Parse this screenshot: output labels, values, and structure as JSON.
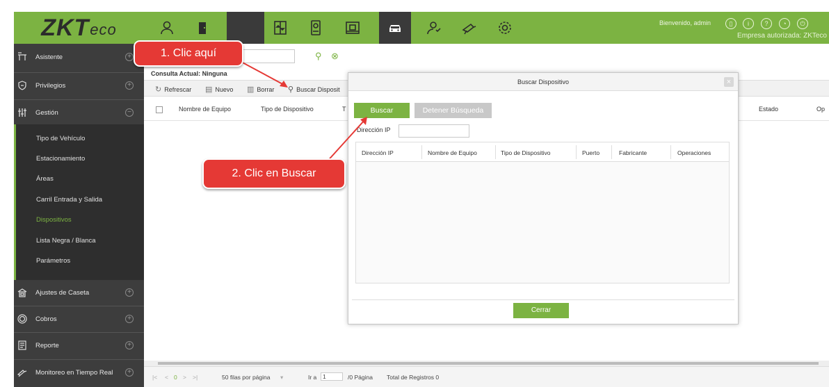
{
  "app": {
    "logo_main": "ZKT",
    "logo_small": "eco",
    "welcome": "Bienvenido, admin",
    "company": "Empresa autorizada: ZKTeco",
    "brand_color": "#7cb342"
  },
  "top_nav": {
    "icons": [
      "person-icon",
      "door-icon",
      "blank-module",
      "elevator-icon",
      "id-card-icon",
      "parking-card-icon",
      "car-icon",
      "guard-icon",
      "camera-icon",
      "gear-icon"
    ],
    "active_index": 2
  },
  "right_icons": [
    "user-icon",
    "info-icon",
    "help-icon",
    "clock-icon",
    "power-icon"
  ],
  "sidebar": {
    "sections": [
      {
        "label": "Asistente",
        "icon": "assistant-icon",
        "state": "+"
      },
      {
        "label": "Privilegios",
        "icon": "shield-icon",
        "state": "+"
      },
      {
        "label": "Gestión",
        "icon": "sliders-icon",
        "state": "−"
      }
    ],
    "sub_items": [
      "Tipo de Vehículo",
      "Estacionamiento",
      "Áreas",
      "Carril Entrada y Salida",
      "Dispositivos",
      "Lista Negra / Blanca",
      "Parámetros"
    ],
    "active_sub": "Dispositivos",
    "bottom_sections": [
      {
        "label": "Ajustes de Caseta",
        "icon": "booth-icon",
        "state": "+"
      },
      {
        "label": "Cobros",
        "icon": "coin-icon",
        "state": "+"
      },
      {
        "label": "Reporte",
        "icon": "report-icon",
        "state": "+"
      },
      {
        "label": "Monitoreo en Tiempo Real",
        "icon": "monitor-icon",
        "state": "+"
      }
    ]
  },
  "main": {
    "consulta": "Consulta Actual: Ninguna",
    "toolbar": {
      "refresh": "Refrescar",
      "new": "Nuevo",
      "delete": "Borrar",
      "search_device": "Buscar Disposit"
    },
    "columns": [
      "Nombre de Equipo",
      "Tipo de Dispositivo",
      "T",
      "Estado",
      "Op"
    ],
    "pager": {
      "nav_first": "|<",
      "nav_prev": "<",
      "current": "0",
      "nav_next": ">",
      "nav_last": ">|",
      "per_page": "50 filas por página",
      "goto_label": "Ir a",
      "goto_value": "1",
      "pages": "/0 Página",
      "total": "Total de Registros 0"
    }
  },
  "dialog": {
    "title": "Buscar Dispositivo",
    "close": "×",
    "search_button": "Buscar",
    "stop_button": "Detener Búsqueda",
    "ip_label": "Dirección IP",
    "columns": [
      "Dirección IP",
      "Nombre de Equipo",
      "Tipo de Dispositivo",
      "Puerto",
      "Fabricante",
      "Operaciones"
    ],
    "close_button": "Cerrar"
  },
  "callouts": {
    "step1": "1. Clic aquí",
    "step2": "2. Clic en Buscar",
    "color": "#e53935"
  }
}
